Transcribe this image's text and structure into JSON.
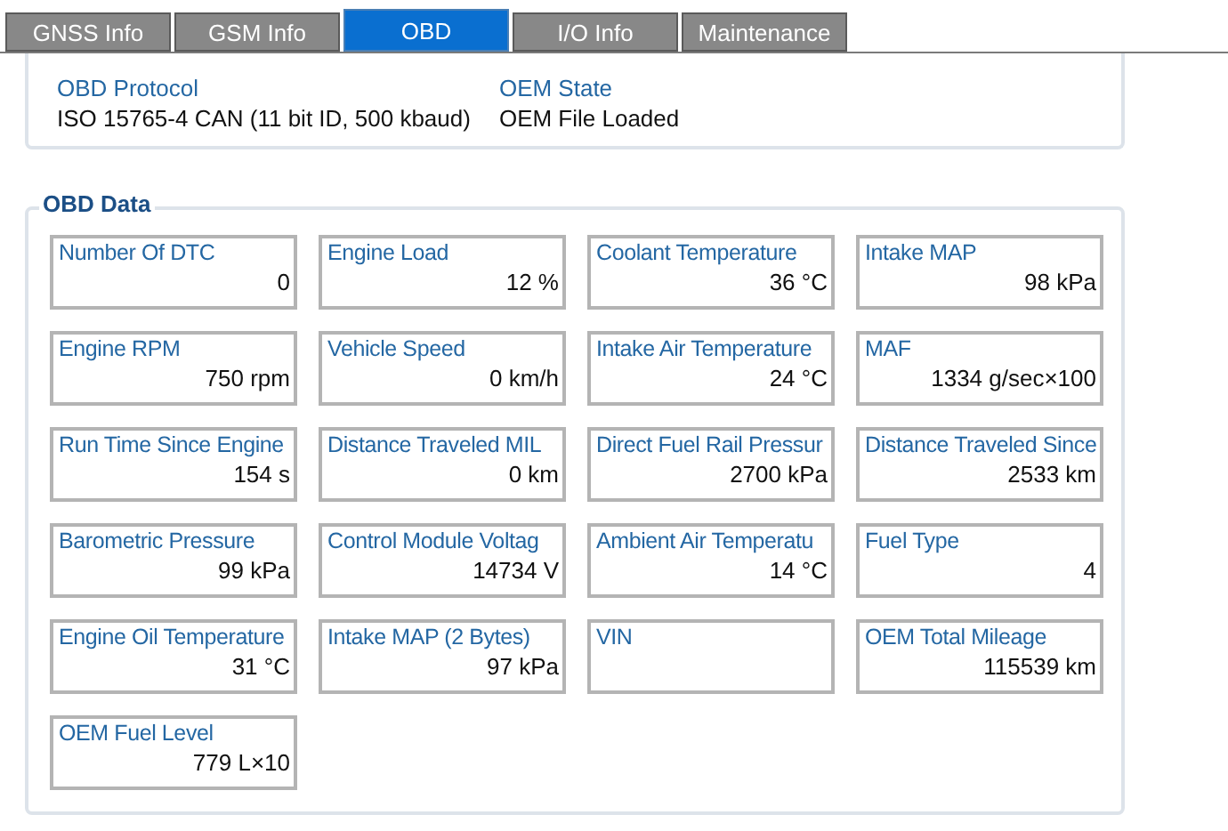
{
  "tabs": [
    {
      "label": "GNSS Info",
      "selected": false
    },
    {
      "label": "GSM Info",
      "selected": false
    },
    {
      "label": "OBD",
      "selected": true
    },
    {
      "label": "I/O Info",
      "selected": false
    },
    {
      "label": "Maintenance",
      "selected": false
    }
  ],
  "protocol_panel": [
    {
      "label": "OBD Protocol",
      "value": "ISO 15765-4 CAN (11 bit ID, 500 kbaud)"
    },
    {
      "label": "OEM State",
      "value": "OEM File Loaded"
    }
  ],
  "obd_data": {
    "title": "OBD Data",
    "items": [
      {
        "label": "Number Of DTC",
        "value": "0"
      },
      {
        "label": "Engine Load",
        "value": "12 %"
      },
      {
        "label": "Coolant Temperature",
        "value": "36 °C"
      },
      {
        "label": "Intake MAP",
        "value": "98 kPa"
      },
      {
        "label": "Engine RPM",
        "value": "750 rpm"
      },
      {
        "label": "Vehicle Speed",
        "value": "0 km/h"
      },
      {
        "label": "Intake Air Temperature",
        "value": "24 °C"
      },
      {
        "label": "MAF",
        "value": "1334 g/sec×100"
      },
      {
        "label": "Run Time Since Engine",
        "value": "154 s"
      },
      {
        "label": "Distance Traveled MIL",
        "value": "0 km"
      },
      {
        "label": "Direct Fuel Rail Pressur",
        "value": "2700 kPa"
      },
      {
        "label": "Distance Traveled Since",
        "value": "2533 km"
      },
      {
        "label": "Barometric Pressure",
        "value": "99 kPa"
      },
      {
        "label": "Control Module Voltag",
        "value": "14734 V"
      },
      {
        "label": "Ambient Air Temperatu",
        "value": "14 °C"
      },
      {
        "label": "Fuel Type",
        "value": "4"
      },
      {
        "label": "Engine Oil Temperature",
        "value": "31 °C"
      },
      {
        "label": "Intake MAP (2 Bytes)",
        "value": "97 kPa"
      },
      {
        "label": "VIN"
      },
      {
        "label": "OEM Total Mileage",
        "value": "115539 km"
      },
      {
        "label": "OEM Fuel Level",
        "value": "779 L×10"
      }
    ]
  }
}
